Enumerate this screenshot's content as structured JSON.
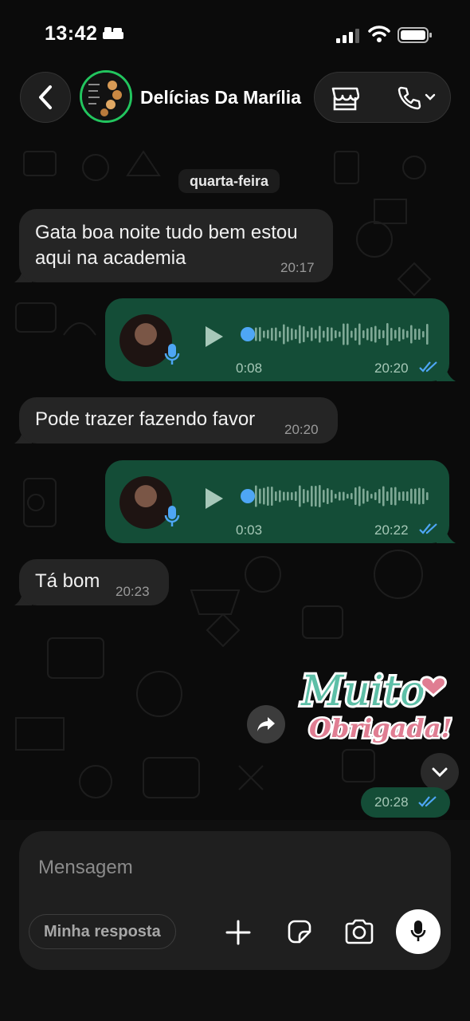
{
  "status_bar": {
    "time": "13:42"
  },
  "header": {
    "contact_name": "Delícias Da Marília"
  },
  "chat": {
    "day_label": "quarta-feira",
    "msg1": {
      "text": "Gata boa noite tudo bem estou aqui na academia",
      "time": "20:17"
    },
    "voice1": {
      "duration": "0:08",
      "time": "20:20"
    },
    "msg2": {
      "text": "Pode trazer fazendo favor",
      "time": "20:20"
    },
    "voice2": {
      "duration": "0:03",
      "time": "20:22"
    },
    "msg3": {
      "text": "Tá bom",
      "time": "20:23"
    },
    "sticker": {
      "line1": "Muito",
      "line2": "Obrigada!",
      "time": "20:28"
    }
  },
  "composer": {
    "placeholder": "Mensagem",
    "quick_reply": "Minha resposta"
  },
  "colors": {
    "outgoing": "#144d37",
    "incoming": "#252525",
    "read_ticks": "#4ea6f5",
    "avatar_ring": "#22c55e"
  }
}
